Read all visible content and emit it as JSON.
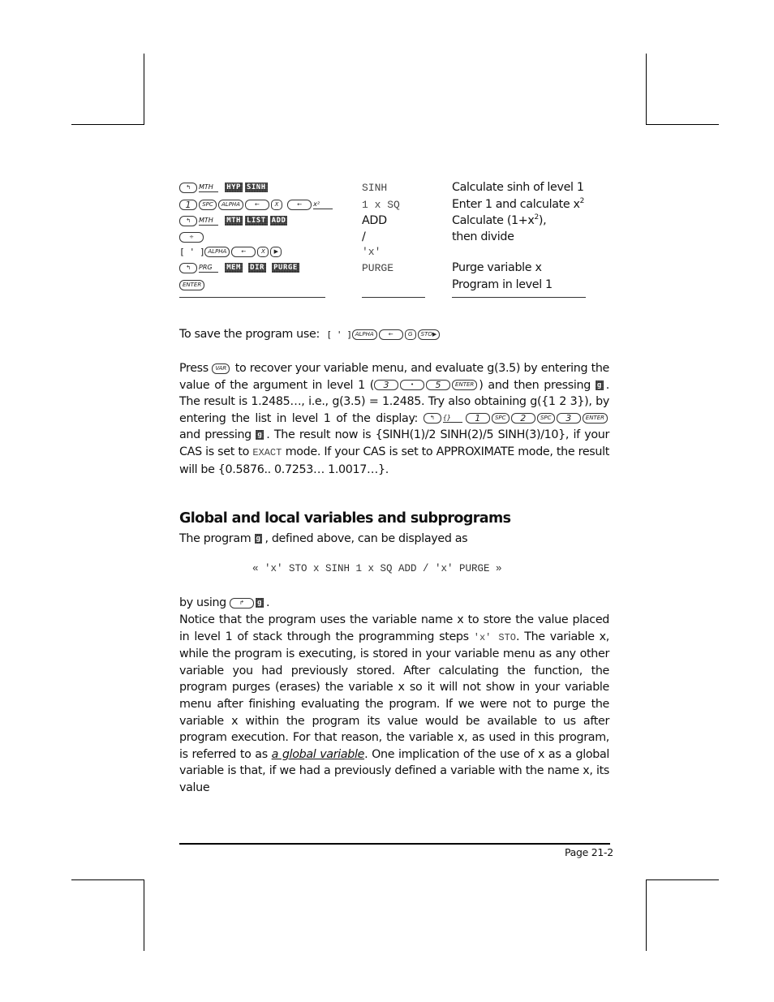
{
  "table": {
    "rows": [
      {
        "keys": {
          "shift": "MTH",
          "softkeys": [
            "HYP",
            "SINH"
          ]
        },
        "code": "SINH",
        "code_mono": true,
        "desc": "Calculate sinh of level 1"
      },
      {
        "keys": {
          "hard": [
            "1",
            "SPC",
            "ALPHA",
            "←",
            "X",
            "←"
          ],
          "shift_after": "x²"
        },
        "code": "1 x SQ",
        "code_mono": true,
        "desc": "Enter 1 and calculate x",
        "desc_sup": "2"
      },
      {
        "keys": {
          "shift": "MTH",
          "softkeys": [
            "MTH",
            "LIST",
            "ADD"
          ]
        },
        "code": "ADD",
        "code_mono": false,
        "desc": "Calculate (1+x",
        "desc_sup": "2",
        "desc_tail": "),"
      },
      {
        "keys": {
          "hard": [
            "÷"
          ]
        },
        "code": "/",
        "code_mono": false,
        "desc": "then divide"
      },
      {
        "keys": {
          "prefix": "[ ' ]",
          "hard": [
            "ALPHA",
            "←",
            "X",
            "▶"
          ]
        },
        "code": "'x'",
        "code_mono": true,
        "desc": ""
      },
      {
        "keys": {
          "shift": "PRG",
          "softkeys": [
            "MEM",
            "DIR",
            "PURGE"
          ]
        },
        "code": "PURGE",
        "code_mono": true,
        "desc": "Purge variable x"
      },
      {
        "keys": {
          "hard": [
            "ENTER"
          ]
        },
        "code": "",
        "code_mono": false,
        "desc": "Program in level 1"
      }
    ]
  },
  "save_line": {
    "text": "To save the program use:",
    "prefix": "[ ' ]",
    "keys": [
      "ALPHA",
      "←",
      "G",
      "STO▶"
    ]
  },
  "para1": {
    "t1": "Press",
    "k_var": "VAR",
    "t2": "to recover your variable menu, and evaluate g(3.5) by entering the value of the argument in level 1 (",
    "keys_a": [
      "3",
      "•",
      "5",
      "ENTER"
    ],
    "t3": ") and then pressing",
    "softkey_g": "g",
    "t4": ". The result is 1.2485…, i.e., g(3.5) = 1.2485.  Try also obtaining g({1 2 3}), by entering the list in level 1 of the display:",
    "keys_b_shift": "{}",
    "keys_b": [
      "1",
      "SPC",
      "2",
      "SPC",
      "3",
      "ENTER"
    ],
    "t5": "and pressing",
    "t6": ". The result now is {SINH(1)/2  SINH(2)/5  SINH(3)/10}, if your CAS is set to",
    "exact": "EXACT",
    "t7": "mode.  If your CAS is set to APPROXIMATE mode, the result will be {0.5876.. 0.7253… 1.0017…}."
  },
  "section": {
    "heading": "Global and local variables and subprograms",
    "intro_a": "The program",
    "intro_b": ", defined above, can be displayed as",
    "code": "« 'x' STO x SINH 1 x SQ ADD / 'x' PURGE »",
    "by_using": "by using",
    "right_shift": "↱",
    "p2_a": "Notice that the program uses the variable name x to store the value placed in level 1 of stack through the programming steps",
    "p2_code": "'x' STO",
    "p2_b": ".  The variable x, while the program is executing, is stored in your variable menu as any other variable you had previously stored.  After calculating the function, the program purges (erases) the variable x so it will not show in your variable menu after finishing evaluating the program.  If we were not to purge the variable x within the program its value would be available to us after program execution. For that reason, the variable x, as used in this program, is referred to as",
    "p2_term": "a global variable",
    "p2_c": ".  One implication of the use of x as a global variable is that, if we had a previously defined a variable with the name x, its value"
  },
  "footer": {
    "page": "Page 21-2"
  }
}
